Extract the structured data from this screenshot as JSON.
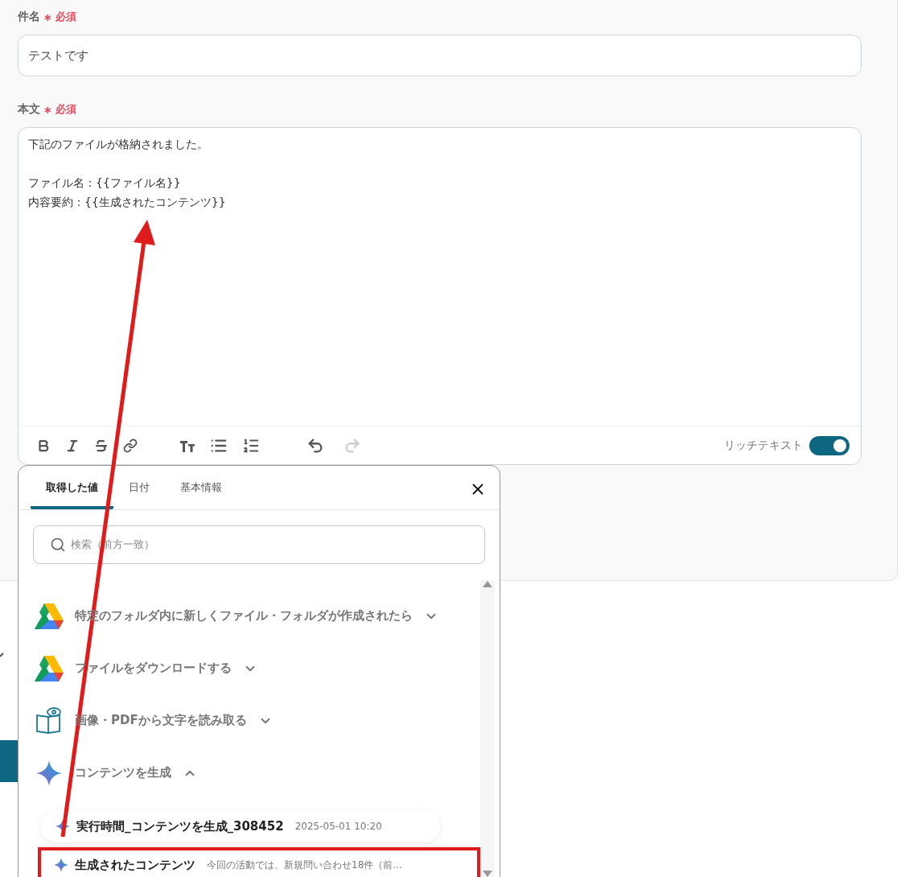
{
  "fields": [
    {
      "kind": "input",
      "label": "件名",
      "required_mark": "∗",
      "required": "必須",
      "value": "テストです"
    },
    {
      "kind": "editor",
      "label": "本文",
      "required_mark": "∗",
      "required": "必須",
      "paragraphs": [
        [
          "下記のファイルが格納されました。"
        ],
        [
          "ファイル名：{{ファイル名}}",
          "内容要約：{{生成されたコンテンツ}}"
        ]
      ],
      "rich_text": {
        "label": "リッチテキスト",
        "on": true
      }
    }
  ],
  "picker": {
    "tabs": [
      {
        "label": "取得した値",
        "selected": true
      },
      {
        "label": "日付",
        "selected": false
      },
      {
        "label": "基本情報",
        "selected": false
      }
    ],
    "search": {
      "placeholder": "検索（前方一致）"
    },
    "groups": [
      {
        "kind": "drive",
        "title": "特定のフォルダ内に新しくファイル・フォルダが作成されたら",
        "expanded": false
      },
      {
        "kind": "drive",
        "title": "ファイルをダウンロードする",
        "expanded": false
      },
      {
        "kind": "ocr",
        "title": "画像・PDFから文字を読み取る",
        "expanded": false
      },
      {
        "kind": "ai",
        "title": "コンテンツを生成",
        "expanded": true,
        "children": [
          {
            "name": "実行時間_コンテンツを生成_308452",
            "value": "2025-05-01 10:20",
            "annotated": false
          },
          {
            "name": "生成されたコンテンツ",
            "value": "今回の活動では、新規問い合わせ18件（前...",
            "annotated": true
          }
        ]
      }
    ]
  },
  "annotation": {
    "kind": "arrow"
  }
}
